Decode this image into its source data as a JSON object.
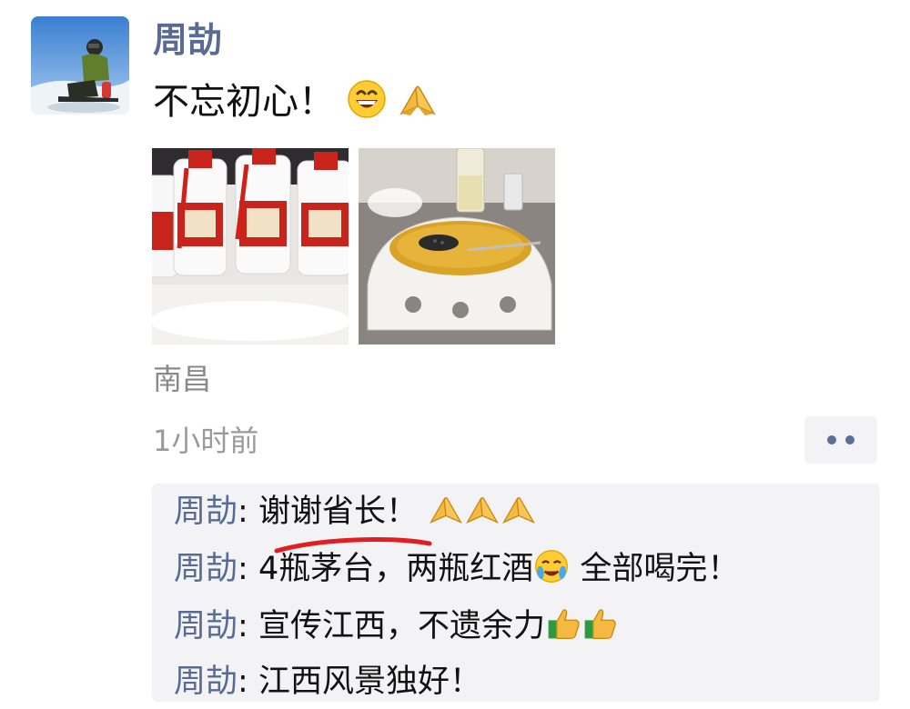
{
  "post": {
    "author": "周劼",
    "text": "不忘初心！",
    "text_emojis": [
      "grinning-face-icon",
      "folded-hands-icon"
    ],
    "photos": [
      {
        "name": "moutai-bottles-photo",
        "description_icon": "liquor-bottles"
      },
      {
        "name": "caviar-soup-photo",
        "description_icon": "dish-with-caviar"
      }
    ],
    "location": "南昌",
    "time": "1小时前"
  },
  "comments": [
    {
      "author": "周劼",
      "sep": ": ",
      "text": "谢谢省长！",
      "emojis": [
        "folded-hands-icon",
        "folded-hands-icon",
        "folded-hands-icon"
      ]
    },
    {
      "author": "周劼",
      "sep": ": ",
      "text": "4瓶茅台，两瓶红酒",
      "mid_emoji": "crying-face-icon",
      "text2": " 全部喝完！"
    },
    {
      "author": "周劼",
      "sep": ": ",
      "text": "宣传江西，不遗余力",
      "emojis": [
        "thumbs-up-icon",
        "thumbs-up-icon"
      ]
    },
    {
      "author": "周劼",
      "sep": ": ",
      "text": "江西风景独好！"
    }
  ],
  "colors": {
    "name_link": "#576b95",
    "comment_bg": "#f3f3f5",
    "meta_text": "#9a9a9a",
    "underline_mark": "#e02020"
  }
}
